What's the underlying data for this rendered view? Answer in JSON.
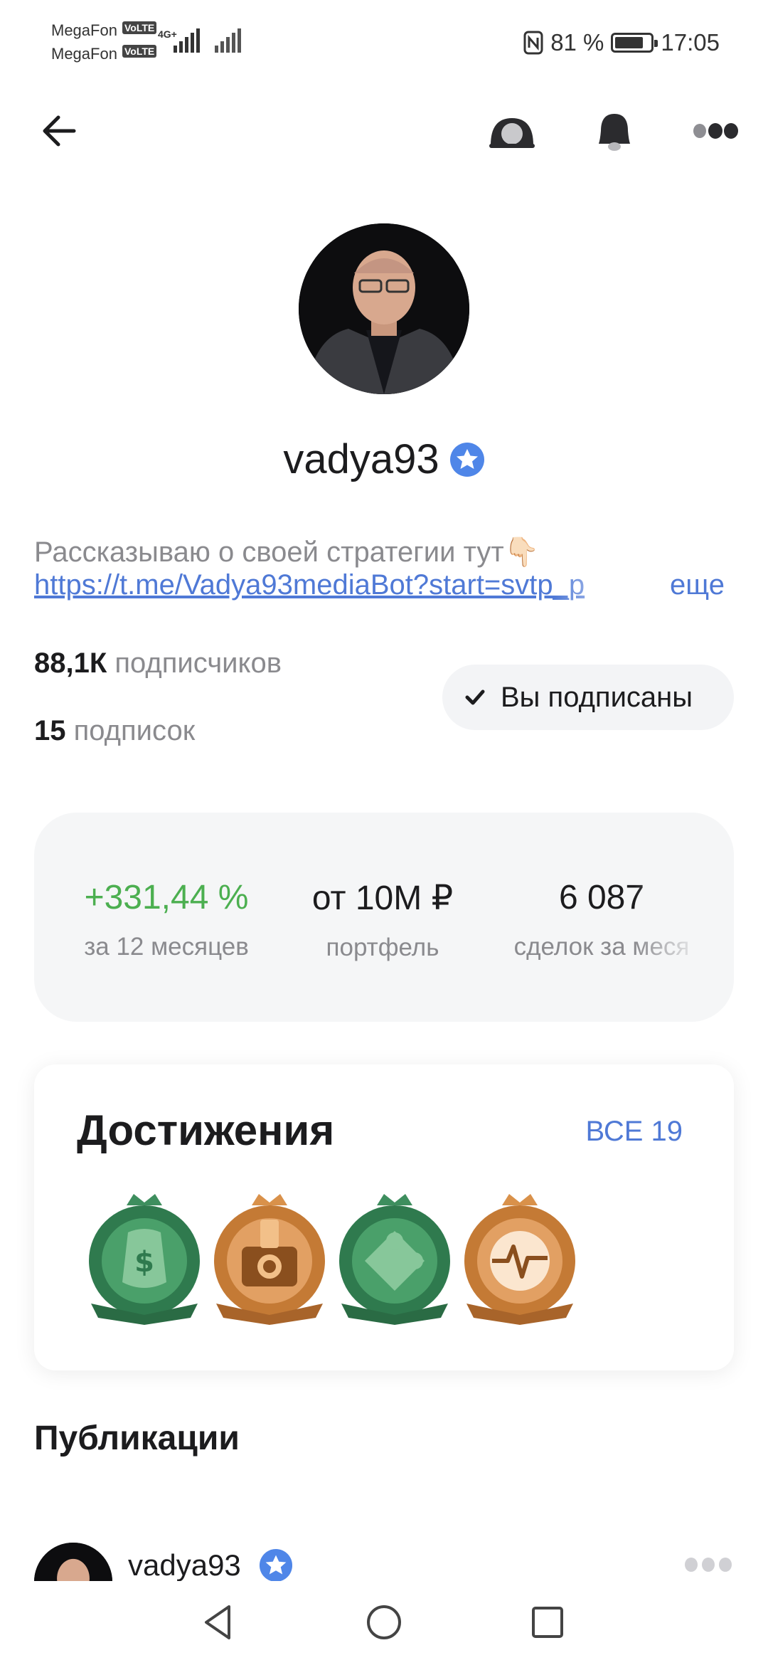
{
  "status_bar": {
    "carrier1": "MegaFon",
    "carrier2": "MegaFon",
    "volte_tag": "VoLTE",
    "network_type": "4G+",
    "battery_percent": "81 %",
    "battery_level": 0.81,
    "time": "17:05",
    "icons": [
      "signal-icon",
      "nfc-icon",
      "battery-icon"
    ]
  },
  "top_nav": {
    "icons": [
      "back-arrow-icon",
      "toggle-icon",
      "bell-icon",
      "more-dots-icon"
    ]
  },
  "profile": {
    "username": "vadya93",
    "verified_icon": "verified-star-icon",
    "bio": "Рассказываю о своей стратегии тут👇🏻",
    "bio_link": "https://t.me/Vadya93mediaBot?start=svtp_p",
    "more_label": "еще",
    "followers_count": "88,1К",
    "followers_label": "подписчиков",
    "following_count": "15",
    "following_label": "подписок",
    "subscribed_label": "Вы подписаны"
  },
  "stats": [
    {
      "value": "+331,44 %",
      "label": "за 12 месяцев"
    },
    {
      "value": "от 10M ₽",
      "label": "портфель"
    },
    {
      "value": "6 087",
      "label": "сделок за меся"
    }
  ],
  "achievements": {
    "title": "Достижения",
    "all_label": "ВСЕ 19",
    "badges": [
      "money-bag-badge-icon",
      "camera-badge-icon",
      "puzzle-badge-icon",
      "pulse-badge-icon"
    ]
  },
  "publications": {
    "title": "Публикации",
    "author": "vadya93"
  },
  "colors": {
    "accent_blue": "#4f79d6",
    "positive_green": "#4caf50",
    "badge_green": "#3e8e5e",
    "badge_bronze": "#d9914a"
  },
  "nav_bar": {
    "icons": [
      "back-triangle-icon",
      "home-circle-icon",
      "recents-square-icon"
    ]
  }
}
